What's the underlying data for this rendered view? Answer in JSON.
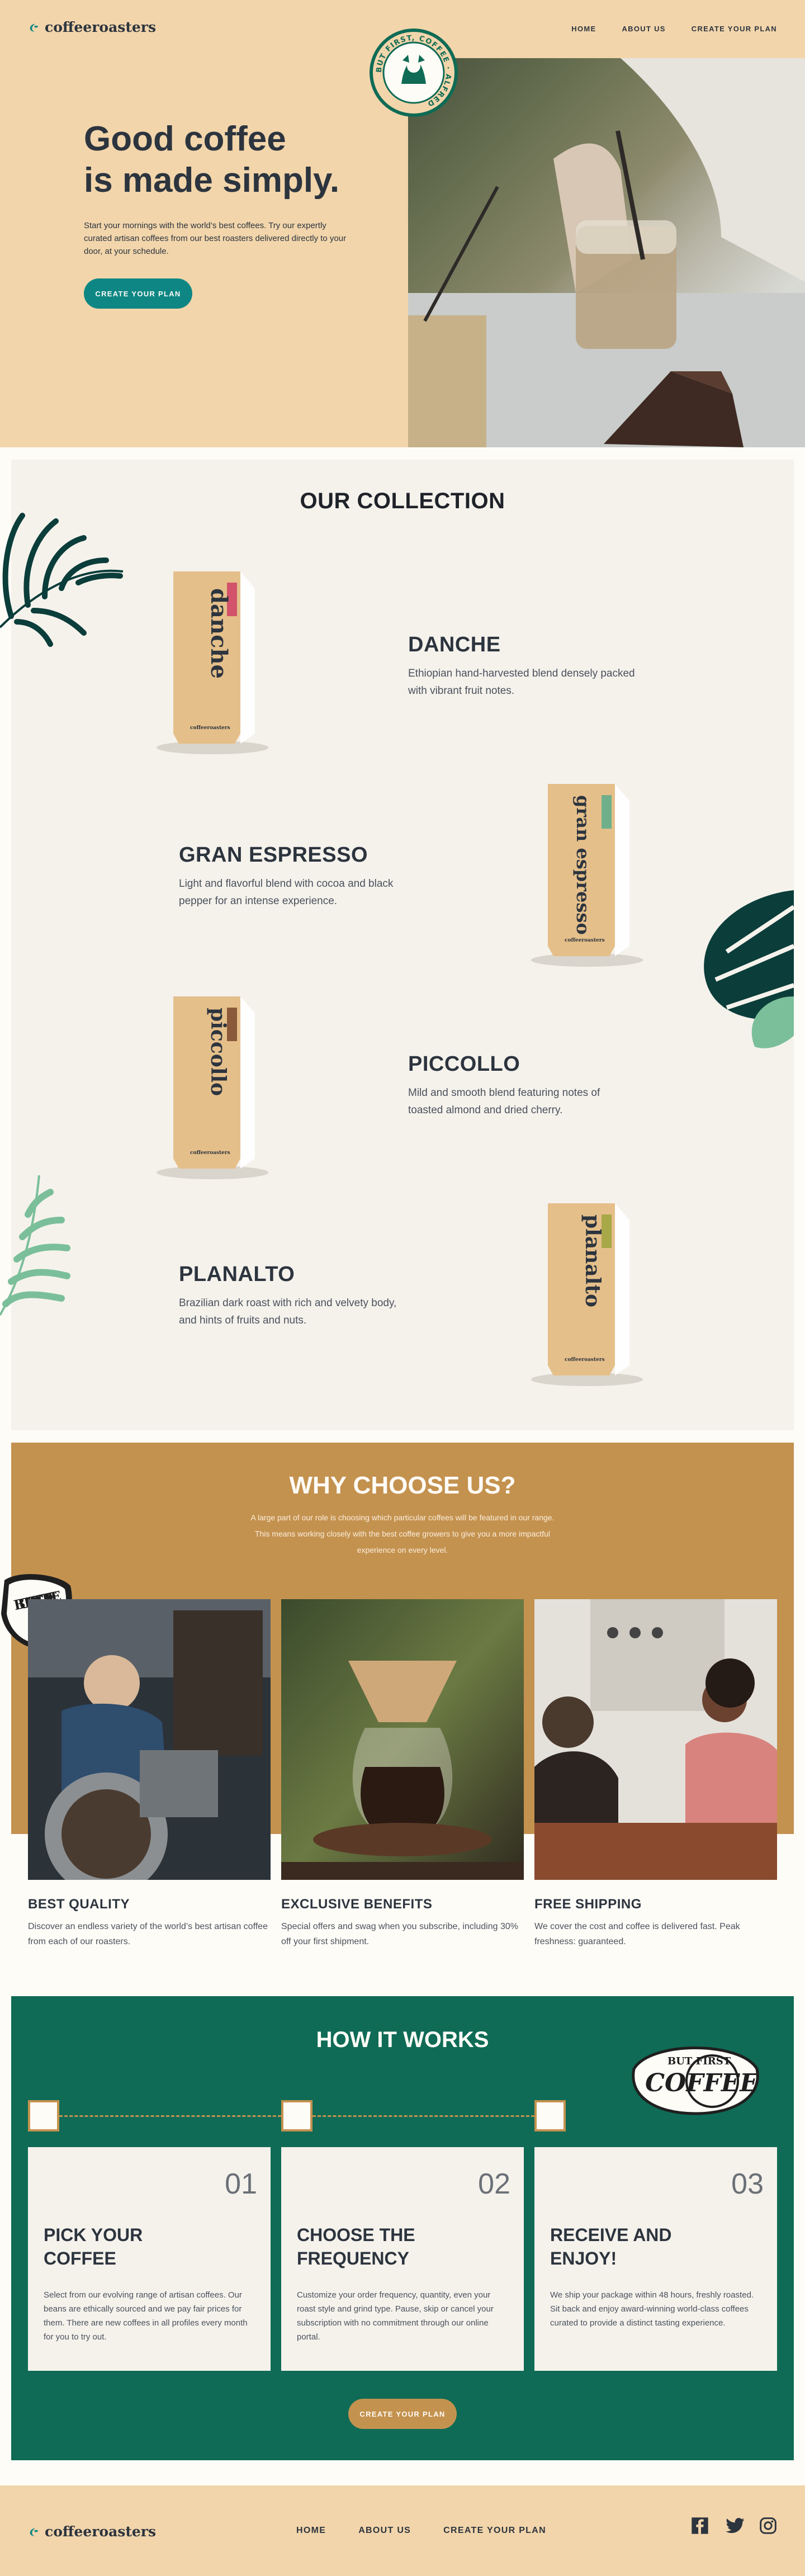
{
  "brand": {
    "name": "coffeeroasters"
  },
  "nav": [
    {
      "label": "HOME"
    },
    {
      "label": "ABOUT US"
    },
    {
      "label": "CREATE YOUR PLAN"
    }
  ],
  "hero": {
    "title": "Good coffee\nis made simply.",
    "lead": "Start your mornings with the world’s best coffees. Try our expertly curated artisan coffees from our best roasters delivered directly to your door, at your schedule.",
    "cta": "CREATE YOUR PLAN",
    "badge_text": "BUT FIRST, COFFEE · ALFRED"
  },
  "collection": {
    "title": "OUR COLLECTION",
    "items": [
      {
        "name": "DANCHE",
        "desc": "Ethiopian hand-harvested blend densely packed with vibrant fruit notes.",
        "bag_label": "danche",
        "accent": "#d2536b"
      },
      {
        "name": "GRAN ESPRESSO",
        "desc": "Light and flavorful blend with cocoa and black pepper for an intense experience.",
        "bag_label": "gran espresso",
        "accent": "#6fb08b"
      },
      {
        "name": "PICCOLLO",
        "desc": "Mild and smooth blend featuring notes of toasted almond and dried cherry.",
        "bag_label": "piccollo",
        "accent": "#8a5a3a"
      },
      {
        "name": "PLANALTO",
        "desc": "Brazilian dark roast with rich and velvety body, and hints of fruits and nuts.",
        "bag_label": "planalto",
        "accent": "#a8a848"
      }
    ],
    "bag_brand": "coffeeroasters"
  },
  "why": {
    "title": "WHY CHOOSE US?",
    "sub": "A large part of our role is choosing which particular coffees will be featured in our range. This means working closely with the best coffee growers to give you a more impactful experience on every level.",
    "sticker_text": "BUT FIRST COFFEE",
    "features": [
      {
        "title": "BEST QUALITY",
        "desc": "Discover an endless variety of the world’s best artisan coffee from each of our roasters."
      },
      {
        "title": "EXCLUSIVE BENEFITS",
        "desc": "Special offers and swag when you subscribe, including 30% off your first shipment."
      },
      {
        "title": "FREE SHIPPING",
        "desc": "We cover the cost and coffee is delivered fast. Peak freshness: guaranteed."
      }
    ]
  },
  "how": {
    "title": "HOW IT WORKS",
    "stamp_top": "BUT FIRST",
    "stamp_main": "COFFEE",
    "steps": [
      {
        "num": "01",
        "title": "PICK YOUR\nCOFFEE",
        "desc": "Select from our evolving range of artisan coffees. Our beans are ethically sourced and we pay fair prices for them. There are new coffees in all profiles every month for you to try out."
      },
      {
        "num": "02",
        "title": "CHOOSE THE\nFREQUENCY",
        "desc": "Customize your order frequency, quantity, even your roast style and grind type. Pause, skip or cancel your subscription with no commitment through our online portal."
      },
      {
        "num": "03",
        "title": "RECEIVE AND\nENJOY!",
        "desc": "We ship your package within 48 hours, freshly roasted. Sit back and enjoy award-winning world-class coffees curated to provide a distinct tasting experience."
      }
    ],
    "cta": "CREATE YOUR PLAN"
  },
  "footer": {
    "nav": [
      {
        "label": "HOME"
      },
      {
        "label": "ABOUT US"
      },
      {
        "label": "CREATE YOUR PLAN"
      }
    ],
    "social": [
      "facebook-icon",
      "twitter-icon",
      "instagram-icon"
    ]
  },
  "colors": {
    "accent": "#0e8784",
    "gold": "#c4924f",
    "green": "#0f6b55",
    "cream": "#f2d5ab"
  }
}
